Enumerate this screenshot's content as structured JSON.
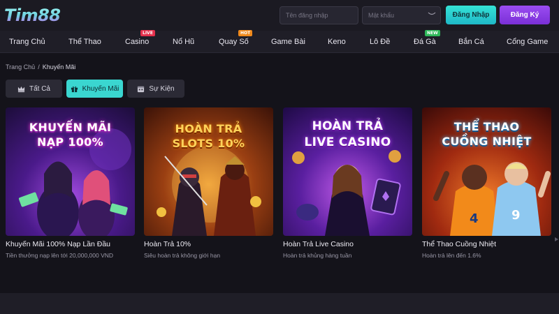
{
  "header": {
    "logo_text": "Tim88",
    "username_placeholder": "Tên đăng nhập",
    "password_placeholder": "Mật khẩu",
    "login_label": "Đăng Nhập",
    "register_label": "Đăng Ký"
  },
  "nav": {
    "items": [
      {
        "label": "Trang Chủ"
      },
      {
        "label": "Thể Thao"
      },
      {
        "label": "Casino",
        "badge": "LIVE",
        "badge_color": "#e5304c"
      },
      {
        "label": "Nổ Hũ"
      },
      {
        "label": "Quay Số",
        "badge": "HOT",
        "badge_color": "#f08a1c"
      },
      {
        "label": "Game Bài"
      },
      {
        "label": "Keno"
      },
      {
        "label": "Lô Đề"
      },
      {
        "label": "Đá Gà",
        "badge": "NEW",
        "badge_color": "#2fb85a"
      },
      {
        "label": "Bắn Cá"
      },
      {
        "label": "Cổng Game"
      }
    ]
  },
  "breadcrumb": {
    "home": "Trang Chủ",
    "separator": "/",
    "current": "Khuyến Mãi"
  },
  "filters": {
    "all": "Tất Cả",
    "promo": "Khuyến Mãi",
    "event": "Sự Kiện"
  },
  "promos": [
    {
      "banner_line1": "KHUYẾN MÃI",
      "banner_line2": "NẠP 100%",
      "title": "Khuyến Mãi 100% Nạp Lần Đầu",
      "subtitle": "Tiền thưởng nạp lên tới 20,000,000 VND"
    },
    {
      "banner_line1": "HOÀN TRẢ",
      "banner_line2": "SLOTS 10%",
      "title": "Hoàn Trả 10%",
      "subtitle": "Siêu hoàn trả không giới hạn"
    },
    {
      "banner_line1": "HOÀN TRẢ",
      "banner_line2": "LIVE CASINO",
      "title": "Hoàn Trả Live Casino",
      "subtitle": "Hoàn trả khủng hàng tuần"
    },
    {
      "banner_line1": "THỂ THAO",
      "banner_line2": "CUỒNG NHIỆT",
      "title": "Thể Thao Cuồng Nhiệt",
      "subtitle": "Hoàn trả lên đến 1.6%"
    }
  ],
  "colors": {
    "accent_cyan": "#3ad6d0",
    "accent_purple": "#8a3be6",
    "background": "#14131a"
  }
}
